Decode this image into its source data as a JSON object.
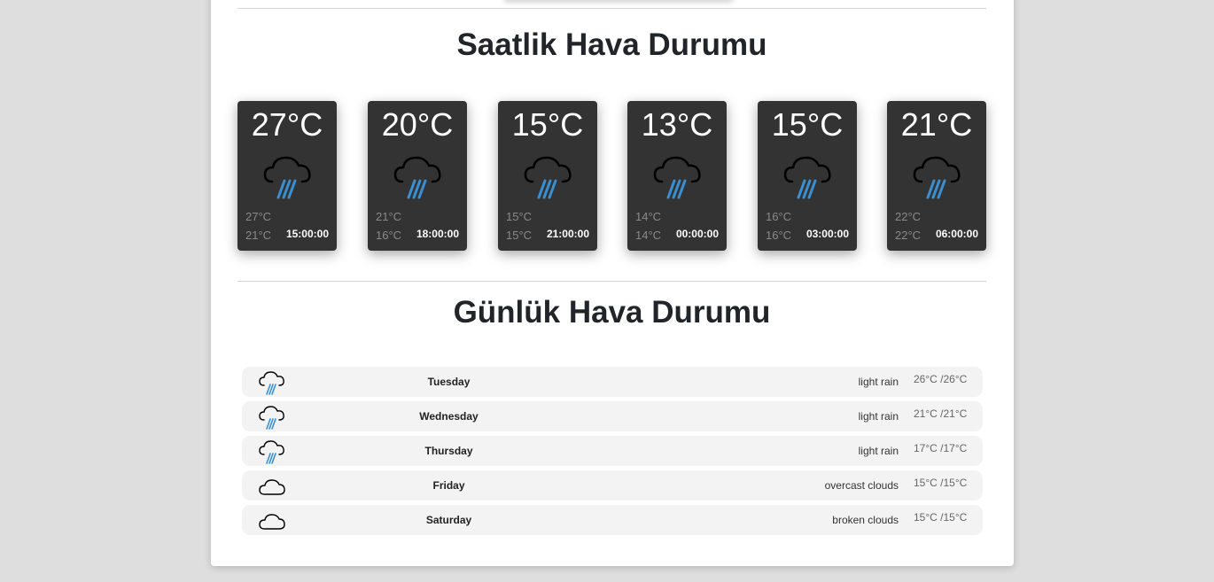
{
  "hourly": {
    "title": "Saatlik Hava Durumu",
    "cards": [
      {
        "temp": "27°C",
        "max": "27°C",
        "min": "21°C",
        "time": "15:00:00",
        "icon": "rain-cloud-icon"
      },
      {
        "temp": "20°C",
        "max": "21°C",
        "min": "16°C",
        "time": "18:00:00",
        "icon": "rain-cloud-icon"
      },
      {
        "temp": "15°C",
        "max": "15°C",
        "min": "15°C",
        "time": "21:00:00",
        "icon": "rain-cloud-icon"
      },
      {
        "temp": "13°C",
        "max": "14°C",
        "min": "14°C",
        "time": "00:00:00",
        "icon": "rain-cloud-icon"
      },
      {
        "temp": "15°C",
        "max": "16°C",
        "min": "16°C",
        "time": "03:00:00",
        "icon": "rain-cloud-icon"
      },
      {
        "temp": "21°C",
        "max": "22°C",
        "min": "22°C",
        "time": "06:00:00",
        "icon": "rain-cloud-icon"
      }
    ]
  },
  "daily": {
    "title": "Günlük Hava Durumu",
    "rows": [
      {
        "day": "Tuesday",
        "desc": "light rain",
        "temp": "26°C /26°C",
        "icon": "rain-cloud-icon"
      },
      {
        "day": "Wednesday",
        "desc": "light rain",
        "temp": "21°C /21°C",
        "icon": "rain-cloud-icon"
      },
      {
        "day": "Thursday",
        "desc": "light rain",
        "temp": "17°C /17°C",
        "icon": "rain-cloud-icon"
      },
      {
        "day": "Friday",
        "desc": "overcast clouds",
        "temp": "15°C /15°C",
        "icon": "cloud-icon"
      },
      {
        "day": "Saturday",
        "desc": "broken clouds",
        "temp": "15°C /15°C",
        "icon": "cloud-icon"
      }
    ]
  },
  "colors": {
    "page_bg": "#dedede",
    "card_bg": "#333333",
    "rain": "#3a8fd0",
    "row_bg": "#f3f3f3"
  }
}
